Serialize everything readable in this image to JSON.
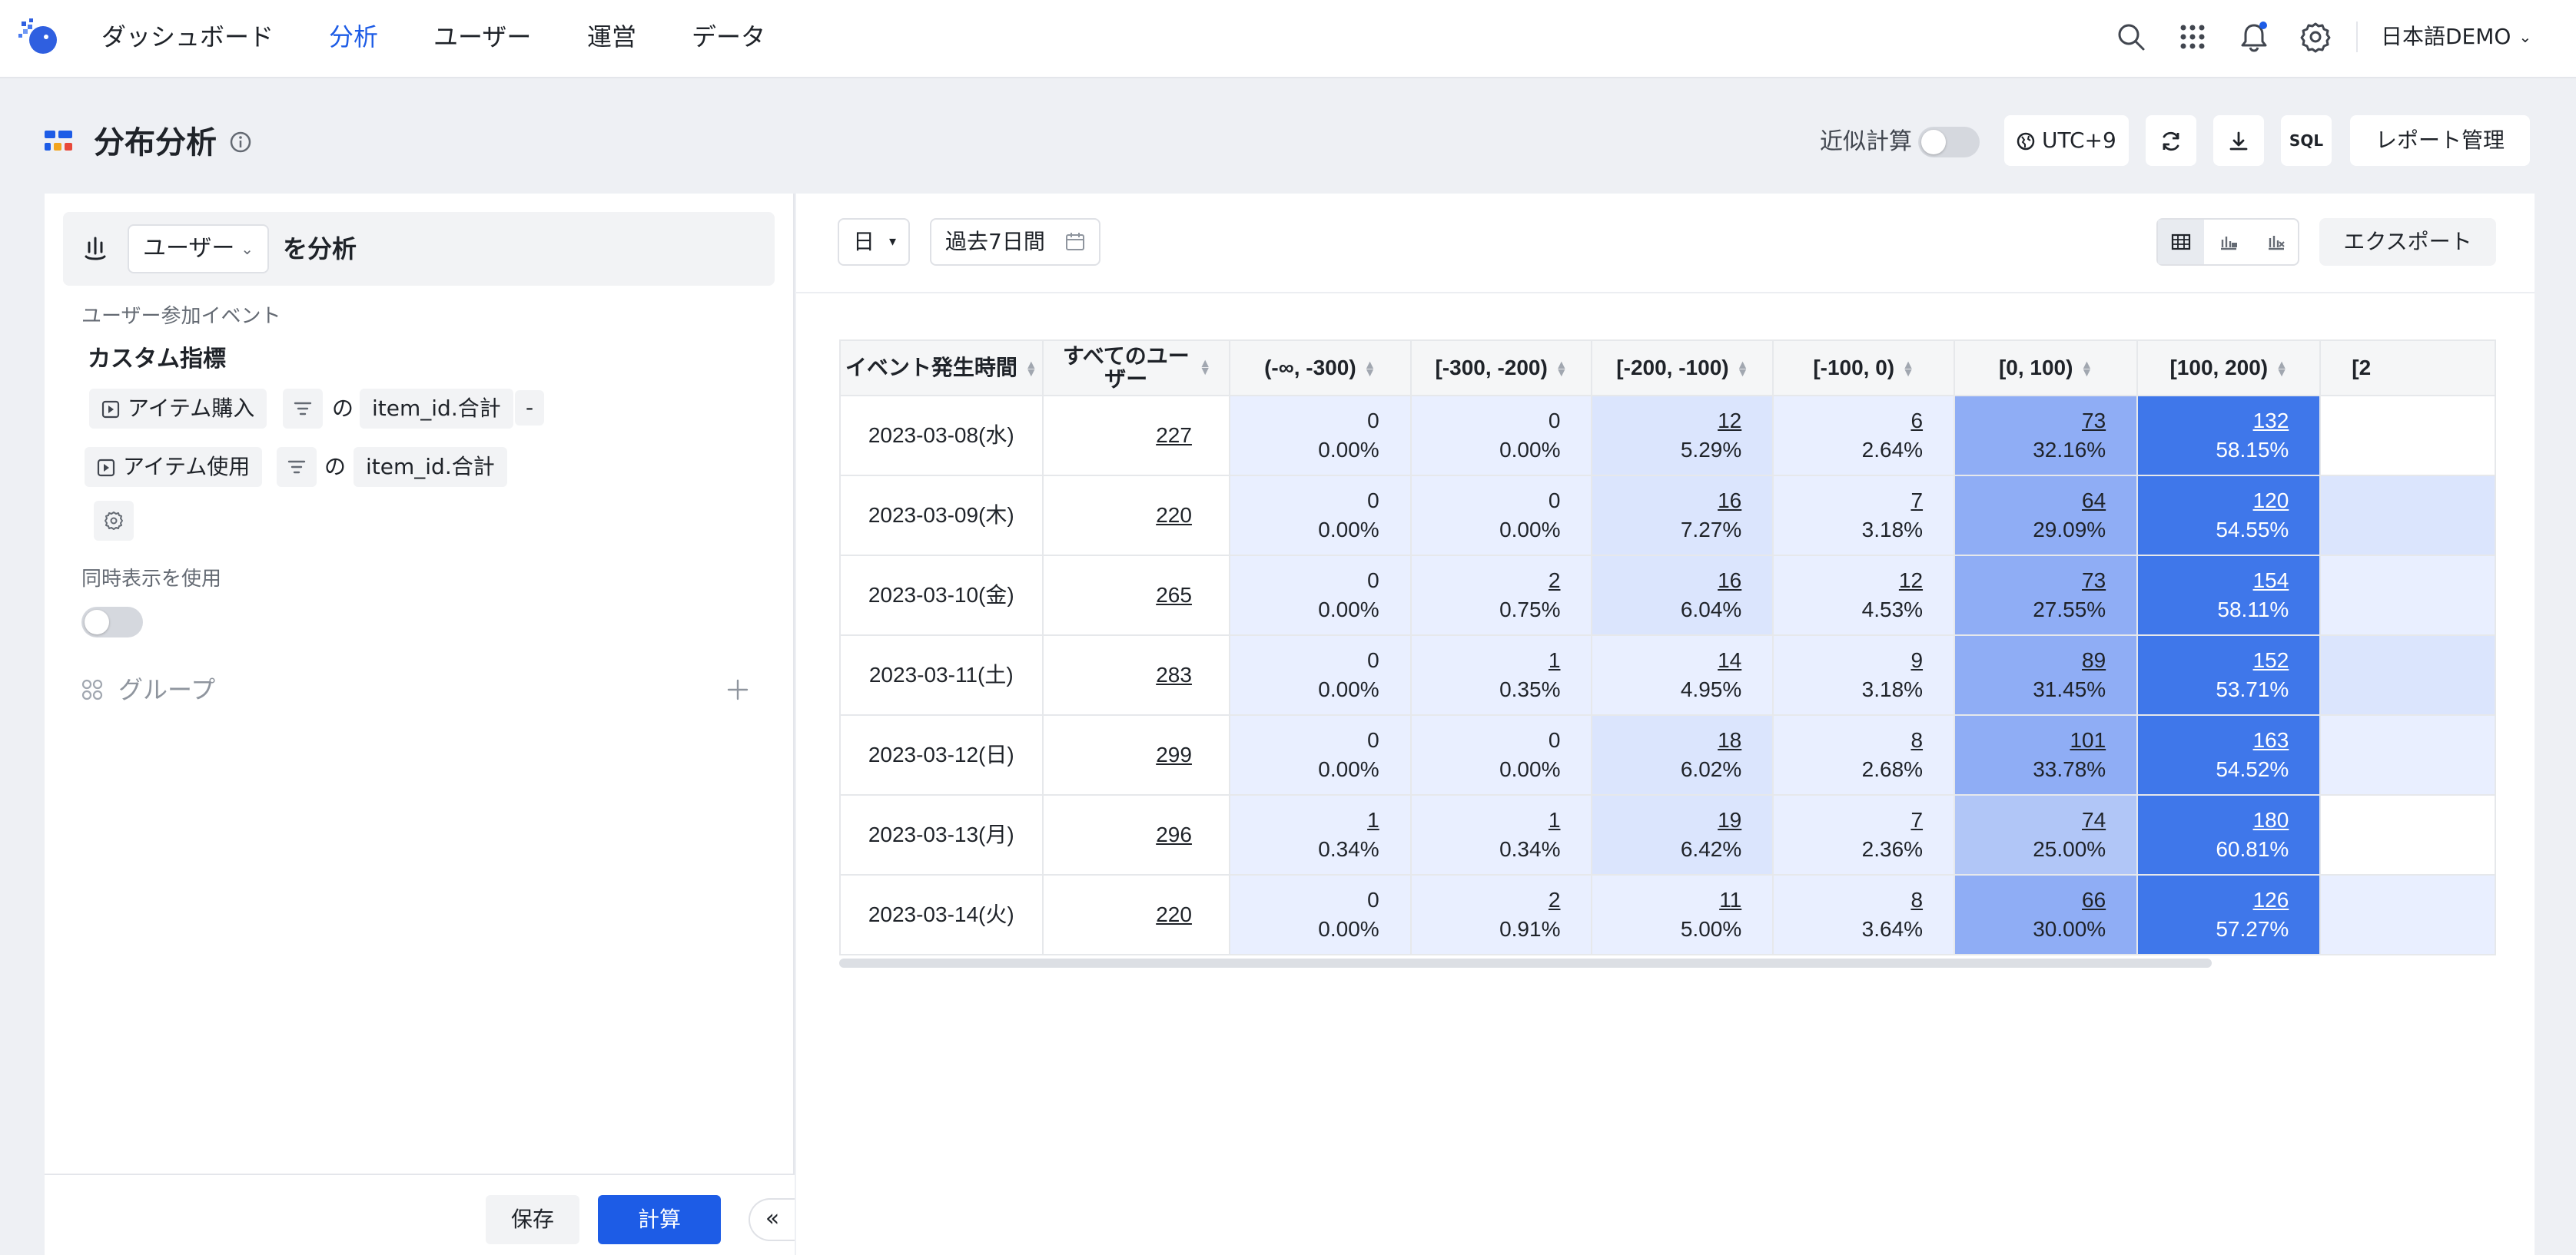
{
  "nav": {
    "items": [
      "ダッシュボード",
      "分析",
      "ユーザー",
      "運営",
      "データ"
    ],
    "active_index": 1,
    "language": "日本語DEMO"
  },
  "header": {
    "title": "分布分析",
    "approx_label": "近似計算",
    "approx_enabled": false,
    "timezone": "UTC+9",
    "sql_label": "SQL",
    "report_button": "レポート管理"
  },
  "left": {
    "user_select": "ユーザー",
    "analyze_suffix": "を分析",
    "participation_label": "ユーザー参加イベント",
    "metric_title": "カスタム指標",
    "row1": {
      "event": "アイテム購入",
      "of": "の",
      "field": "item_id.合計",
      "operator": "-"
    },
    "row2": {
      "event": "アイテム使用",
      "of": "の",
      "field": "item_id.合計"
    },
    "simultaneous_label": "同時表示を使用",
    "simultaneous_enabled": false,
    "group_label": "グループ",
    "save_button": "保存",
    "calc_button": "計算",
    "collapse_label": "«"
  },
  "toolbar": {
    "granularity": "日",
    "date_range": "過去7日間",
    "export_button": "エクスポート"
  },
  "colors": {
    "accent": "#1d5ce6",
    "heat_1": "#e9efff",
    "heat_2": "#dbe5fd",
    "heat_3": "#b1c6f7",
    "heat_4": "#8fadf5",
    "heat_5": "#3f77ea"
  },
  "table": {
    "headers": [
      "イベント発生時間",
      "すべてのユーザー",
      "(-∞, -300)",
      "[-300, -200)",
      "[-200, -100)",
      "[-100, 0)",
      "[0, 100)",
      "[100, 200)",
      "[2"
    ],
    "rows": [
      {
        "date": "2023-03-08(水)",
        "total": "227",
        "cells": [
          {
            "count": "0",
            "pct": "0.00%",
            "link": false,
            "heat": 1
          },
          {
            "count": "0",
            "pct": "0.00%",
            "link": false,
            "heat": 1
          },
          {
            "count": "12",
            "pct": "5.29%",
            "link": true,
            "heat": 2
          },
          {
            "count": "6",
            "pct": "2.64%",
            "link": true,
            "heat": 1
          },
          {
            "count": "73",
            "pct": "32.16%",
            "link": true,
            "heat": 4
          },
          {
            "count": "132",
            "pct": "58.15%",
            "link": true,
            "heat": 5
          },
          {
            "count": "",
            "pct": "",
            "link": false,
            "heat": 0
          }
        ]
      },
      {
        "date": "2023-03-09(木)",
        "total": "220",
        "cells": [
          {
            "count": "0",
            "pct": "0.00%",
            "link": false,
            "heat": 1
          },
          {
            "count": "0",
            "pct": "0.00%",
            "link": false,
            "heat": 1
          },
          {
            "count": "16",
            "pct": "7.27%",
            "link": true,
            "heat": 2
          },
          {
            "count": "7",
            "pct": "3.18%",
            "link": true,
            "heat": 1
          },
          {
            "count": "64",
            "pct": "29.09%",
            "link": true,
            "heat": 4
          },
          {
            "count": "120",
            "pct": "54.55%",
            "link": true,
            "heat": 5
          },
          {
            "count": "",
            "pct": "",
            "link": false,
            "heat": 2
          }
        ]
      },
      {
        "date": "2023-03-10(金)",
        "total": "265",
        "cells": [
          {
            "count": "0",
            "pct": "0.00%",
            "link": false,
            "heat": 1
          },
          {
            "count": "2",
            "pct": "0.75%",
            "link": true,
            "heat": 1
          },
          {
            "count": "16",
            "pct": "6.04%",
            "link": true,
            "heat": 2
          },
          {
            "count": "12",
            "pct": "4.53%",
            "link": true,
            "heat": 1
          },
          {
            "count": "73",
            "pct": "27.55%",
            "link": true,
            "heat": 4
          },
          {
            "count": "154",
            "pct": "58.11%",
            "link": true,
            "heat": 5
          },
          {
            "count": "",
            "pct": "",
            "link": false,
            "heat": 1
          }
        ]
      },
      {
        "date": "2023-03-11(土)",
        "total": "283",
        "cells": [
          {
            "count": "0",
            "pct": "0.00%",
            "link": false,
            "heat": 1
          },
          {
            "count": "1",
            "pct": "0.35%",
            "link": true,
            "heat": 1
          },
          {
            "count": "14",
            "pct": "4.95%",
            "link": true,
            "heat": 1
          },
          {
            "count": "9",
            "pct": "3.18%",
            "link": true,
            "heat": 1
          },
          {
            "count": "89",
            "pct": "31.45%",
            "link": true,
            "heat": 4
          },
          {
            "count": "152",
            "pct": "53.71%",
            "link": true,
            "heat": 5
          },
          {
            "count": "",
            "pct": "",
            "link": false,
            "heat": 2
          }
        ]
      },
      {
        "date": "2023-03-12(日)",
        "total": "299",
        "cells": [
          {
            "count": "0",
            "pct": "0.00%",
            "link": false,
            "heat": 1
          },
          {
            "count": "0",
            "pct": "0.00%",
            "link": false,
            "heat": 1
          },
          {
            "count": "18",
            "pct": "6.02%",
            "link": true,
            "heat": 2
          },
          {
            "count": "8",
            "pct": "2.68%",
            "link": true,
            "heat": 1
          },
          {
            "count": "101",
            "pct": "33.78%",
            "link": true,
            "heat": 4
          },
          {
            "count": "163",
            "pct": "54.52%",
            "link": true,
            "heat": 5
          },
          {
            "count": "",
            "pct": "",
            "link": false,
            "heat": 1
          }
        ]
      },
      {
        "date": "2023-03-13(月)",
        "total": "296",
        "cells": [
          {
            "count": "1",
            "pct": "0.34%",
            "link": true,
            "heat": 1
          },
          {
            "count": "1",
            "pct": "0.34%",
            "link": true,
            "heat": 1
          },
          {
            "count": "19",
            "pct": "6.42%",
            "link": true,
            "heat": 2
          },
          {
            "count": "7",
            "pct": "2.36%",
            "link": true,
            "heat": 1
          },
          {
            "count": "74",
            "pct": "25.00%",
            "link": true,
            "heat": 3
          },
          {
            "count": "180",
            "pct": "60.81%",
            "link": true,
            "heat": 5
          },
          {
            "count": "",
            "pct": "",
            "link": false,
            "heat": 0
          }
        ]
      },
      {
        "date": "2023-03-14(火)",
        "total": "220",
        "cells": [
          {
            "count": "0",
            "pct": "0.00%",
            "link": false,
            "heat": 1
          },
          {
            "count": "2",
            "pct": "0.91%",
            "link": true,
            "heat": 1
          },
          {
            "count": "11",
            "pct": "5.00%",
            "link": true,
            "heat": 1
          },
          {
            "count": "8",
            "pct": "3.64%",
            "link": true,
            "heat": 1
          },
          {
            "count": "66",
            "pct": "30.00%",
            "link": true,
            "heat": 4
          },
          {
            "count": "126",
            "pct": "57.27%",
            "link": true,
            "heat": 5
          },
          {
            "count": "",
            "pct": "",
            "link": false,
            "heat": 1
          }
        ]
      }
    ]
  }
}
